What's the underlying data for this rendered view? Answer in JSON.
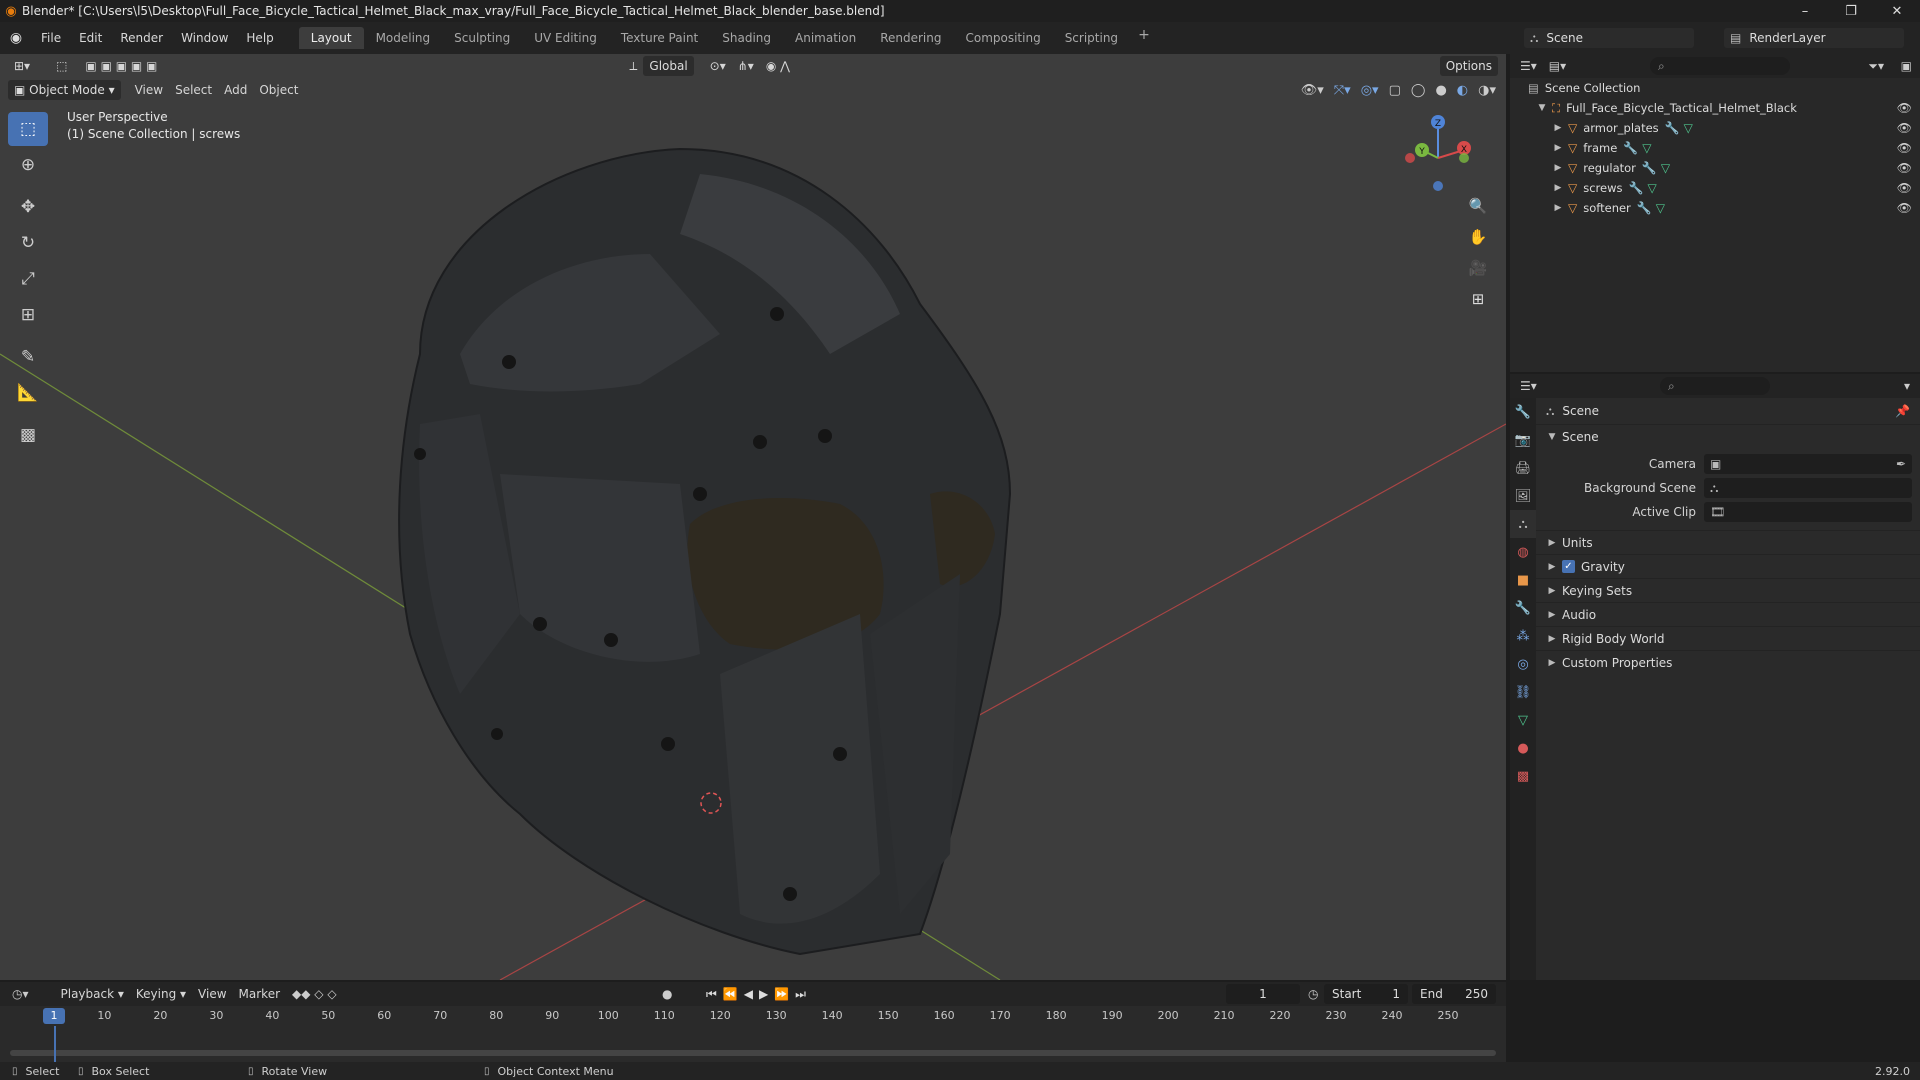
{
  "window": {
    "title": "Blender* [C:\\Users\\l5\\Desktop\\Full_Face_Bicycle_Tactical_Helmet_Black_max_vray/Full_Face_Bicycle_Tactical_Helmet_Black_blender_base.blend]",
    "controls": [
      "–",
      "❐",
      "✕"
    ]
  },
  "menu": [
    "File",
    "Edit",
    "Render",
    "Window",
    "Help"
  ],
  "workspaces": {
    "tabs": [
      "Layout",
      "Modeling",
      "Sculpting",
      "UV Editing",
      "Texture Paint",
      "Shading",
      "Animation",
      "Rendering",
      "Compositing",
      "Scripting"
    ],
    "active": "Layout",
    "add": "+"
  },
  "scene_selector": {
    "value": "Scene"
  },
  "view_layer_selector": {
    "value": "RenderLayer"
  },
  "viewport": {
    "mode": "Object Mode",
    "menus": [
      "View",
      "Select",
      "Add",
      "Object"
    ],
    "orientation": "Global",
    "options": "Options",
    "info_line1": "User Perspective",
    "info_line2": "(1) Scene Collection | screws",
    "gizmo": {
      "x": "X",
      "y": "Y",
      "z": "Z"
    }
  },
  "outliner": {
    "root": "Scene Collection",
    "collection": "Full_Face_Bicycle_Tactical_Helmet_Black",
    "objects": [
      "armor_plates",
      "frame",
      "regulator",
      "screws",
      "softener"
    ]
  },
  "properties": {
    "context": "Scene",
    "panel_title": "Scene",
    "fields": [
      {
        "label": "Camera",
        "value": ""
      },
      {
        "label": "Background Scene",
        "value": ""
      },
      {
        "label": "Active Clip",
        "value": ""
      }
    ],
    "panels": [
      "Units",
      "Gravity",
      "Keying Sets",
      "Audio",
      "Rigid Body World",
      "Custom Properties"
    ],
    "gravity_checked": true
  },
  "timeline": {
    "menus": [
      "Playback",
      "Keying",
      "View",
      "Marker"
    ],
    "current_frame": "1",
    "start_label": "Start",
    "start": "1",
    "end_label": "End",
    "end": "250",
    "ruler": [
      "1",
      "10",
      "20",
      "30",
      "40",
      "50",
      "60",
      "70",
      "80",
      "90",
      "100",
      "110",
      "120",
      "130",
      "140",
      "150",
      "160",
      "170",
      "180",
      "190",
      "200",
      "210",
      "220",
      "230",
      "240",
      "250"
    ]
  },
  "statusbar": {
    "select": "Select",
    "box_select": "Box Select",
    "rotate_view": "Rotate View",
    "context_menu": "Object Context Menu",
    "version": "2.92.0"
  }
}
